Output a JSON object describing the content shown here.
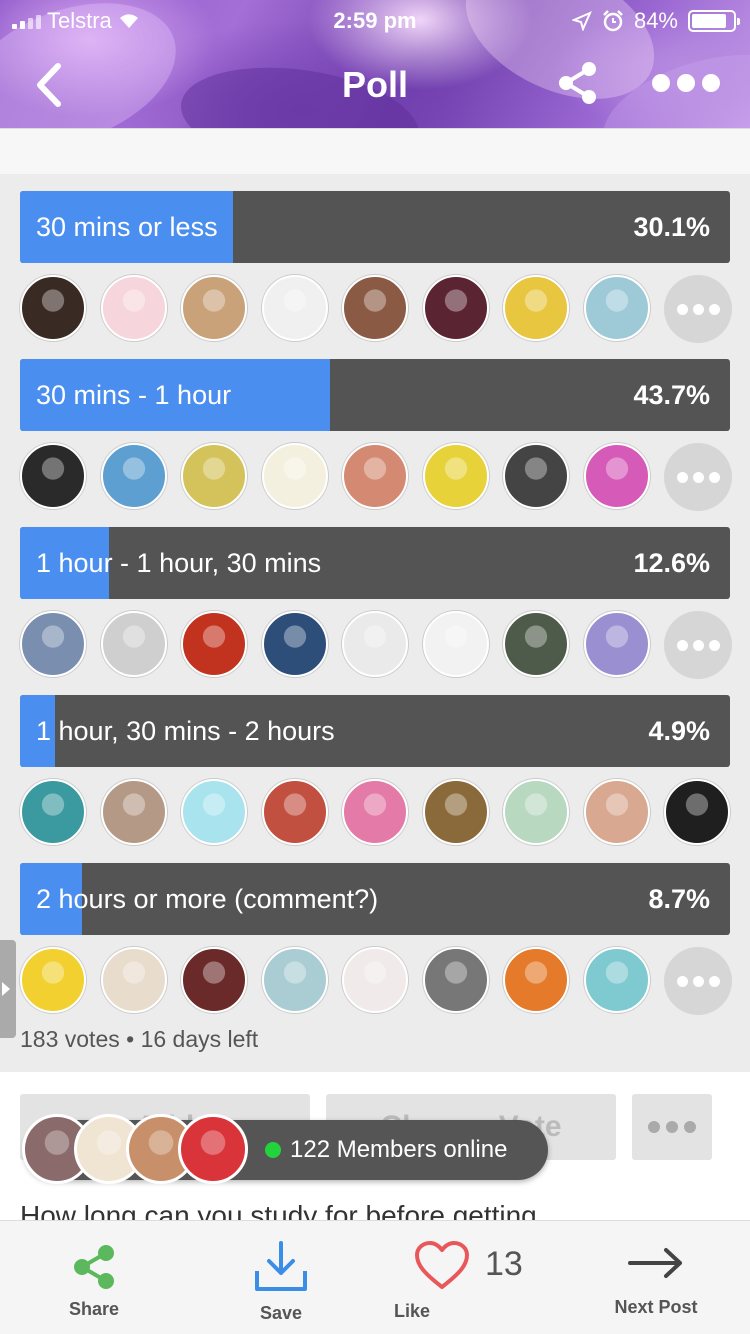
{
  "status_bar": {
    "carrier": "Telstra",
    "time": "2:59 pm",
    "battery": "84%",
    "battery_level": 0.84
  },
  "header": {
    "title": "Poll",
    "back_icon": "chevron-left-icon",
    "share_icon": "share-icon",
    "more_icon": "more-dots-icon"
  },
  "poll": {
    "options": [
      {
        "label": "30 mins or less",
        "percent": "30.1%",
        "fraction": 0.3,
        "voter_colors": [
          "#3a2a24",
          "#f6d6dc",
          "#c9a27a",
          "#f0f0f0",
          "#8a5a44",
          "#5b2433",
          "#e8c640",
          "#9ecad8"
        ],
        "show_more": true
      },
      {
        "label": "30 mins - 1 hour",
        "percent": "43.7%",
        "fraction": 0.437,
        "voter_colors": [
          "#2a2a2a",
          "#5c9fd0",
          "#d3c35a",
          "#f4f0e0",
          "#d48a72",
          "#e8d23a",
          "#444444",
          "#d65ab8"
        ],
        "show_more": true
      },
      {
        "label": "1 hour - 1 hour, 30 mins",
        "percent": "12.6%",
        "fraction": 0.126,
        "voter_colors": [
          "#7a8fb0",
          "#cfcfcf",
          "#c2331f",
          "#2e4e7a",
          "#eaeaea",
          "#f2f2f2",
          "#4e5a4a",
          "#9a8fd0"
        ],
        "show_more": true
      },
      {
        "label": "1 hour, 30 mins - 2 hours",
        "percent": "4.9%",
        "fraction": 0.049,
        "voter_colors": [
          "#3a9aa0",
          "#b49a86",
          "#a9e4ee",
          "#c25040",
          "#e47aa8",
          "#8a6a3a",
          "#b8d8c0",
          "#d8a890",
          "#1f1f1f"
        ],
        "show_more": false
      },
      {
        "label": "2 hours or more (comment?)",
        "percent": "8.7%",
        "fraction": 0.087,
        "voter_colors": [
          "#f2d030",
          "#e8dccc",
          "#6a2a2a",
          "#a9cdd2",
          "#f0eaea",
          "#777777",
          "#e47a2a",
          "#7fcad0"
        ],
        "show_more": true
      }
    ],
    "summary": "183 votes • 16 days left"
  },
  "actions": {
    "add_label": "Add",
    "change_vote_label": "Change Vote",
    "more_icon": "more-dots-icon"
  },
  "post_title_peek": "How long can you study for before getting",
  "online": {
    "text": "122 Members online",
    "avatar_colors": [
      "#8a6a6a",
      "#f0e4d2",
      "#c8906a",
      "#d8343a"
    ]
  },
  "bottom_bar": {
    "share_label": "Share",
    "save_label": "Save",
    "like_label": "Like",
    "like_count": "13",
    "next_label": "Next Post",
    "colors": {
      "share": "#5cb85c",
      "save": "#3a8ee6",
      "like": "#e8585a",
      "next": "#555555"
    }
  }
}
